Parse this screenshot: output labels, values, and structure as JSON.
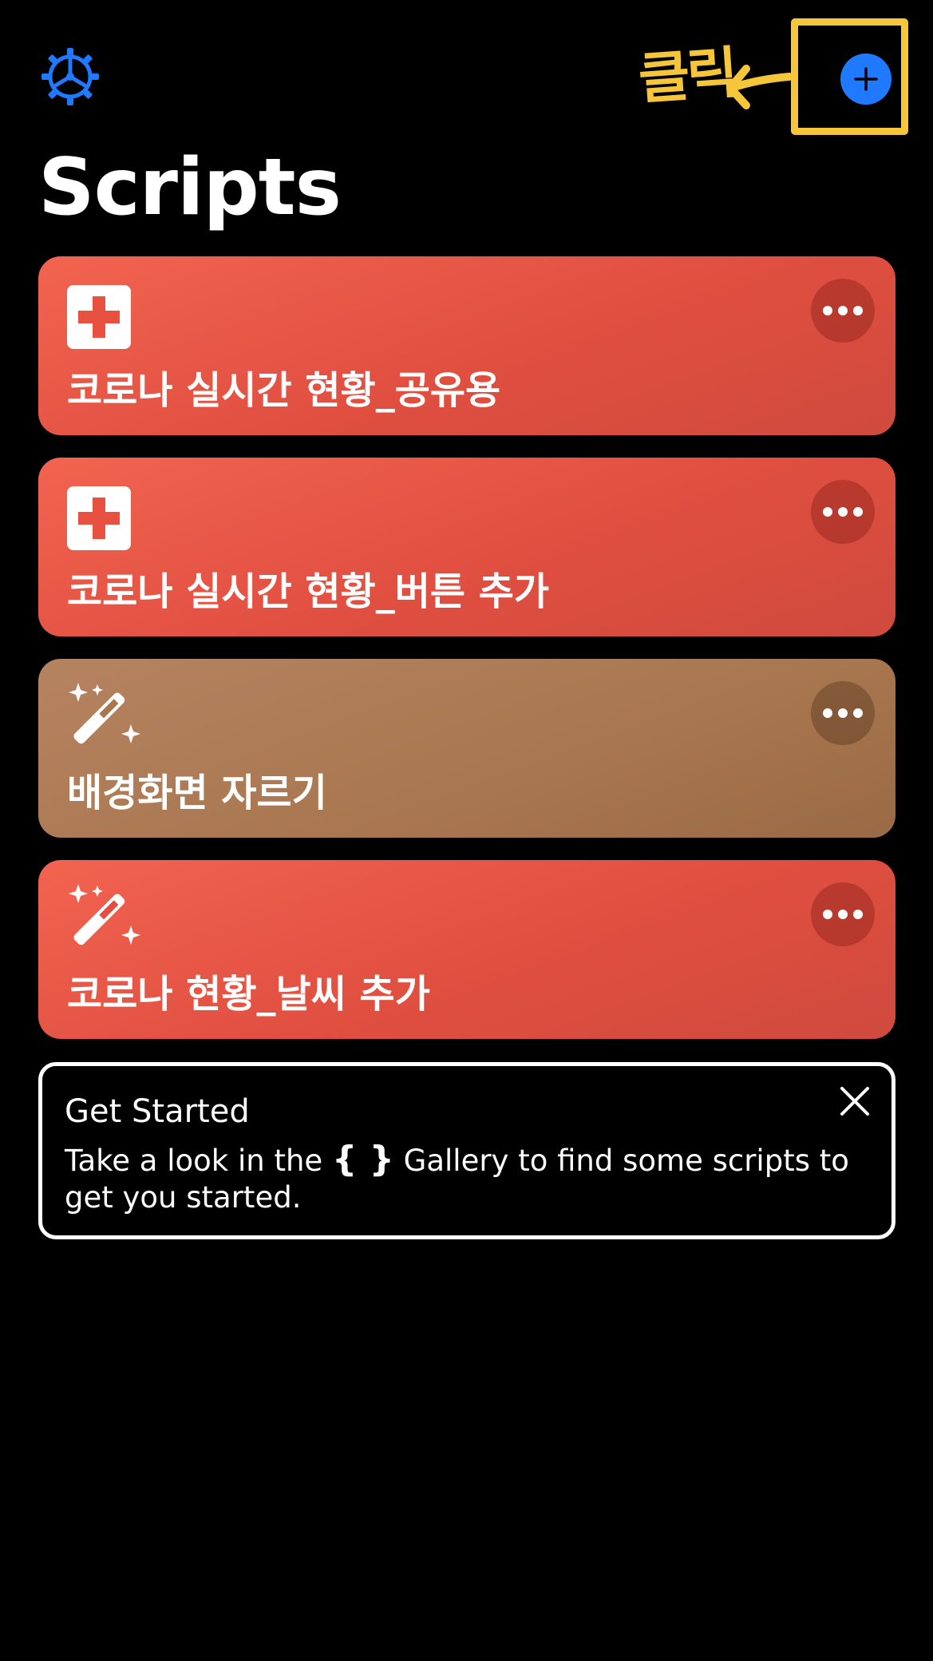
{
  "header": {
    "settings_icon": "gear-icon",
    "add_icon": "plus-icon",
    "annotation_text": "클릭",
    "annotation_color": "#f5c53a",
    "accent_color": "#1f7aff"
  },
  "page_title": "Scripts",
  "scripts": [
    {
      "title": "코로나 실시간 현황_공유용",
      "icon": "medical-cross-icon",
      "color": "#ea5647"
    },
    {
      "title": "코로나 실시간 현황_버튼 추가",
      "icon": "medical-cross-icon",
      "color": "#ea5647"
    },
    {
      "title": "배경화면 자르기",
      "icon": "magic-wand-icon",
      "color": "#a8774f"
    },
    {
      "title": "코로나 현황_날씨 추가",
      "icon": "magic-wand-icon",
      "color": "#ea5647"
    }
  ],
  "get_started": {
    "title": "Get Started",
    "body_before": "Take a look in the",
    "braces": "{ }",
    "body_after": "Gallery to find some scripts to get you started.",
    "close_icon": "close-icon"
  }
}
